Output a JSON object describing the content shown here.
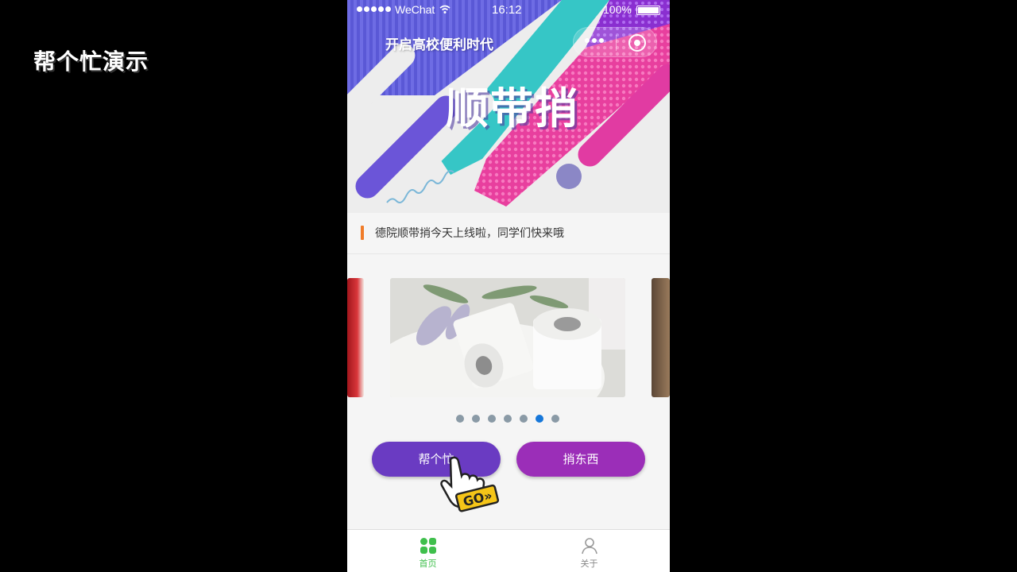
{
  "demo_title": "帮个忙演示",
  "status_bar": {
    "carrier": "WeChat",
    "time": "16:12",
    "battery": "100%"
  },
  "banner": {
    "subtitle": "开启高校便利时代",
    "title": "顺带捎"
  },
  "notice": {
    "text": "德院顺带捎今天上线啦，同学们快来哦"
  },
  "carousel": {
    "slide_count": 7,
    "active_index": 5
  },
  "actions": {
    "help_label": "帮个忙",
    "bring_label": "捎东西"
  },
  "cursor": {
    "badge": "GO»"
  },
  "tabbar": {
    "items": [
      {
        "label": "首页",
        "icon": "grid-icon",
        "active": true
      },
      {
        "label": "关于",
        "icon": "user-icon",
        "active": false
      }
    ]
  },
  "colors": {
    "accent_green": "#3fbf4c",
    "button_purple": "#6a3bc2",
    "button_magenta": "#9b2eb8",
    "notice_bar": "#f07c2a",
    "dot_active": "#1677d9"
  }
}
